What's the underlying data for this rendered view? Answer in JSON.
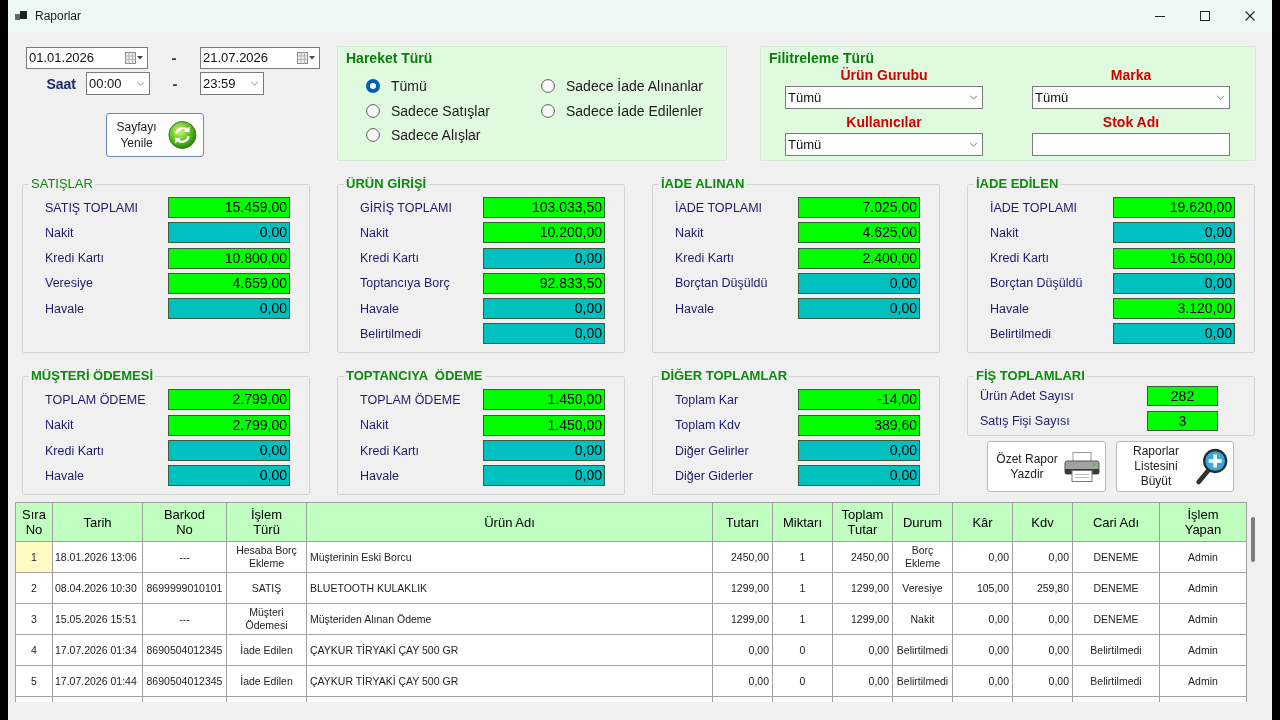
{
  "window": {
    "title": "Raporlar"
  },
  "date_filter": {
    "start_date": "01.01.2026",
    "date_separator": "-",
    "end_date": "21.07.2026",
    "time_label": "Saat",
    "start_time": "00:00",
    "time_separator": "-",
    "end_time": "23:59"
  },
  "refresh_button": {
    "label": "Sayfayı Yenile"
  },
  "movement_type": {
    "title": "Hareket Türü",
    "options": [
      {
        "label": "Tümü",
        "selected": true
      },
      {
        "label": "Sadece Satışlar",
        "selected": false
      },
      {
        "label": "Sadece Alışlar",
        "selected": false
      },
      {
        "label": "Sadece İade Alınanlar",
        "selected": false
      },
      {
        "label": "Sadece İade Edilenler",
        "selected": false
      }
    ]
  },
  "filter_type": {
    "title": "Filitreleme Türü",
    "fields": [
      {
        "label": "Ürün Gurubu",
        "kind": "combo",
        "value": "Tümü"
      },
      {
        "label": "Marka",
        "kind": "combo",
        "value": "Tümü"
      },
      {
        "label": "Kullanıcılar",
        "kind": "combo",
        "value": "Tümü"
      },
      {
        "label": "Stok Adı",
        "kind": "text"
      }
    ]
  },
  "summary_panels": [
    {
      "title": "SATIŞLAR",
      "bold": false,
      "rows": [
        {
          "label": "SATIŞ TOPLAMI",
          "value": "15.459,00",
          "color": "#00ff00"
        },
        {
          "label": "Nakit",
          "value": "0,00",
          "color": "#00c0c0"
        },
        {
          "label": "Kredi Kartı",
          "value": "10.800,00",
          "color": "#00ff00"
        },
        {
          "label": "Veresiye",
          "value": "4.659,00",
          "color": "#00ff00"
        },
        {
          "label": "Havale",
          "value": "0,00",
          "color": "#00c0c0"
        }
      ]
    },
    {
      "title": "ÜRÜN GİRİŞİ",
      "bold": true,
      "rows": [
        {
          "label": "GİRİŞ TOPLAMI",
          "value": "103.033,50",
          "color": "#00ff00"
        },
        {
          "label": "Nakit",
          "value": "10.200,00",
          "color": "#00ff00"
        },
        {
          "label": "Kredi Kartı",
          "value": "0,00",
          "color": "#00c0c0"
        },
        {
          "label": "Toptancıya Borç",
          "value": "92.833,50",
          "color": "#00ff00"
        },
        {
          "label": "Havale",
          "value": "0,00",
          "color": "#00c0c0"
        },
        {
          "label": "Belirtilmedi",
          "value": "0,00",
          "color": "#00c0c0"
        }
      ]
    },
    {
      "title": "İADE ALINAN",
      "bold": true,
      "rows": [
        {
          "label": "İADE TOPLAMI",
          "value": "7.025,00",
          "color": "#00ff00"
        },
        {
          "label": "Nakit",
          "value": "4.625,00",
          "color": "#00ff00"
        },
        {
          "label": "Kredi Kartı",
          "value": "2.400,00",
          "color": "#00ff00"
        },
        {
          "label": "Borçtan Düşüldü",
          "value": "0,00",
          "color": "#00c0c0"
        },
        {
          "label": "Havale",
          "value": "0,00",
          "color": "#00c0c0"
        }
      ]
    },
    {
      "title": "İADE EDİLEN",
      "bold": true,
      "rows": [
        {
          "label": "İADE TOPLAMI",
          "value": "19.620,00",
          "color": "#00ff00"
        },
        {
          "label": "Nakit",
          "value": "0,00",
          "color": "#00c0c0"
        },
        {
          "label": "Kredi Kartı",
          "value": "16.500,00",
          "color": "#00ff00"
        },
        {
          "label": "Borçtan Düşüldü",
          "value": "0,00",
          "color": "#00c0c0"
        },
        {
          "label": "Havale",
          "value": "3.120,00",
          "color": "#00ff00"
        },
        {
          "label": "Belirtilmedi",
          "value": "0,00",
          "color": "#00c0c0"
        }
      ]
    },
    {
      "title": "MÜŞTERİ ÖDEMESİ",
      "bold": true,
      "rows": [
        {
          "label": "TOPLAM ÖDEME",
          "value": "2.799,00",
          "color": "#00ff00"
        },
        {
          "label": "Nakit",
          "value": "2.799,00",
          "color": "#00ff00"
        },
        {
          "label": "Kredi Kartı",
          "value": "0,00",
          "color": "#00c0c0"
        },
        {
          "label": "Havale",
          "value": "0,00",
          "color": "#00c0c0"
        }
      ]
    },
    {
      "title": "TOPTANCIYA  ÖDEME",
      "bold": true,
      "rows": [
        {
          "label": "TOPLAM ÖDEME",
          "value": "1.450,00",
          "color": "#00ff00"
        },
        {
          "label": "Nakit",
          "value": "1.450,00",
          "color": "#00ff00"
        },
        {
          "label": "Kredi Kartı",
          "value": "0,00",
          "color": "#00c0c0"
        },
        {
          "label": "Havale",
          "value": "0,00",
          "color": "#00c0c0"
        }
      ]
    },
    {
      "title": "DİĞER TOPLAMLAR",
      "bold": true,
      "rows": [
        {
          "label": "Toplam Kar",
          "value": "-14,00",
          "color": "#00ff00"
        },
        {
          "label": "Toplam Kdv",
          "value": "389,60",
          "color": "#00ff00"
        },
        {
          "label": "Diğer Gelirler",
          "value": "0,00",
          "color": "#00c0c0"
        },
        {
          "label": "Diğer Giderler",
          "value": "0,00",
          "color": "#00c0c0"
        }
      ]
    }
  ],
  "receipt_totals": {
    "title": "FİŞ TOPLAMLARI",
    "rows": [
      {
        "label": "Ürün Adet Sayısı",
        "value": "282",
        "color": "#00ff00"
      },
      {
        "label": "Satış Fişi Sayısı",
        "value": "3",
        "color": "#00ff00"
      }
    ]
  },
  "print_button": {
    "label": "Özet Rapor Yazdir"
  },
  "enlarge_button": {
    "label": "Raporlar Listesini Büyüt"
  },
  "table": {
    "columns": [
      "Sıra No",
      "Tarih",
      "Barkod No",
      "İşlem Türü",
      "Ürün Adı",
      "Tutarı",
      "Miktarı",
      "Toplam Tutar",
      "Durum",
      "Kâr",
      "Kdv",
      "Cari Adı",
      "İşlem Yapan"
    ],
    "rows": [
      {
        "selected": true,
        "cells": [
          "1",
          "18.01.2026 13:06",
          "---",
          "Hesaba Borç Ekleme",
          "Müşterinin Eski Borcu",
          "2450,00",
          "1",
          "2450,00",
          "Borç Ekleme",
          "0,00",
          "0,00",
          "DENEME",
          "Admin"
        ]
      },
      {
        "selected": false,
        "cells": [
          "2",
          "08.04.2026 10:30",
          "8699999010101",
          "SATIŞ",
          "BLUETOOTH KULAKLIK",
          "1299,00",
          "1",
          "1299,00",
          "Veresiye",
          "105,00",
          "259,80",
          "DENEME",
          "Admin"
        ]
      },
      {
        "selected": false,
        "cells": [
          "3",
          "15.05.2026 15:51",
          "---",
          "Müşteri Ödemesi",
          "Müşteriden Alınan Ödeme",
          "1299,00",
          "1",
          "1299,00",
          "Nakit",
          "0,00",
          "0,00",
          "DENEME",
          "Admin"
        ]
      },
      {
        "selected": false,
        "cells": [
          "4",
          "17.07.2026 01:34",
          "8690504012345",
          "İade Edilen",
          "ÇAYKUR TİRYAKİ ÇAY 500 GR",
          "0,00",
          "0",
          "0,00",
          "Belirtilmedi",
          "0,00",
          "0,00",
          "Belirtilmedi",
          "Admin"
        ]
      },
      {
        "selected": false,
        "cells": [
          "5",
          "17.07.2026 01:44",
          "8690504012345",
          "İade Edilen",
          "ÇAYKUR TİRYAKİ ÇAY 500 GR",
          "0,00",
          "0",
          "0,00",
          "Belirtilmedi",
          "0,00",
          "0,00",
          "Belirtilmedi",
          "Admin"
        ]
      }
    ]
  }
}
